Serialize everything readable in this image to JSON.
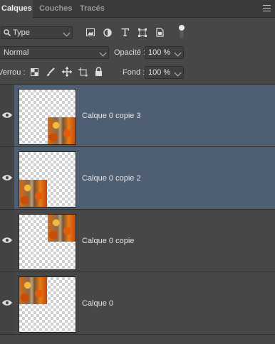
{
  "tabs": [
    {
      "label": "Calques",
      "active": true
    },
    {
      "label": "Couches",
      "active": false
    },
    {
      "label": "Tracés",
      "active": false
    }
  ],
  "filter": {
    "value": "Type"
  },
  "blend": {
    "value": "Normal",
    "opacity_label": "Opacité :",
    "opacity_value": "100 %"
  },
  "lock": {
    "label": "Verrou :",
    "fill_label": "Fond :",
    "fill_value": "100 %"
  },
  "layers": [
    {
      "name": "Calque 0 copie 3",
      "selected": true,
      "photo_pos": "bottom-right"
    },
    {
      "name": "Calque 0 copie 2",
      "selected": true,
      "photo_pos": "bottom-left"
    },
    {
      "name": "Calque 0 copie",
      "selected": false,
      "photo_pos": "top-right"
    },
    {
      "name": "Calque 0",
      "selected": false,
      "photo_pos": "top-left"
    }
  ],
  "colors": {
    "panel": "#474747",
    "selected": "#4e5e73",
    "tabbar": "#3a3a3a"
  }
}
